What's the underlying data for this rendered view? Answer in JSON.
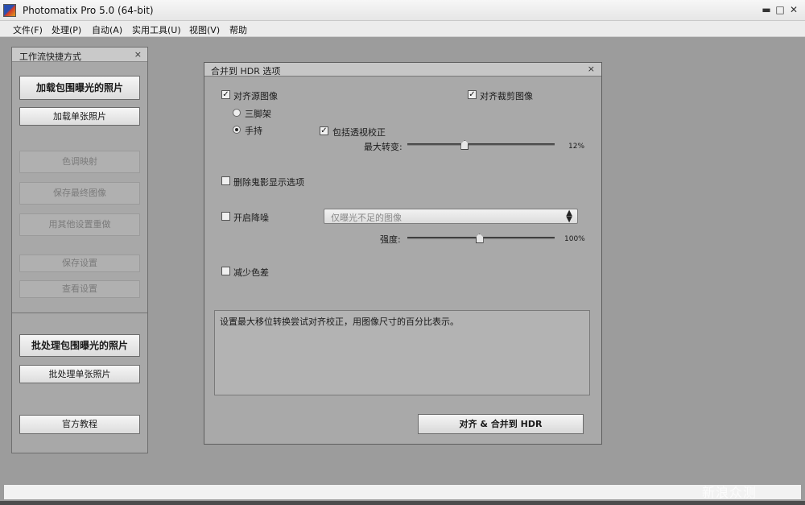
{
  "window": {
    "title": "Photomatix Pro 5.0 (64-bit)",
    "min": "▬",
    "max": "□",
    "close": "✕"
  },
  "menu": [
    "文件(F)",
    "处理(P)",
    "自动(A)",
    "实用工具(U)",
    "视图(V)",
    "帮助"
  ],
  "workflow": {
    "title": "工作流快捷方式",
    "close": "×",
    "load_bracketed": "加载包围曝光的照片",
    "load_single": "加载单张照片",
    "tone_mapping": "色调映射",
    "save_final": "保存最终图像",
    "reprocess": "用其他设置重做",
    "save_settings": "保存设置",
    "view_settings": "查看设置",
    "batch_bracketed": "批处理包围曝光的照片",
    "batch_single": "批处理单张照片",
    "tutorials": "官方教程"
  },
  "dialog": {
    "title": "合并到 HDR 选项",
    "close": "×",
    "align_source": {
      "label": "对齐源图像",
      "checked": true
    },
    "crop_aligned": {
      "label": "对齐裁剪图像",
      "checked": true
    },
    "tripod": {
      "label": "三脚架",
      "selected": false
    },
    "handheld": {
      "label": "手持",
      "selected": true
    },
    "perspective": {
      "label": "包括透视校正",
      "checked": true
    },
    "max_shift": {
      "label": "最大转变:",
      "value": "12%",
      "fraction": 0.39
    },
    "deghost": {
      "label": "删除鬼影显示选项",
      "checked": false
    },
    "noise": {
      "label": "开启降噪",
      "checked": false
    },
    "noise_target": {
      "selected": "仅曝光不足的图像",
      "arrow": "▲▼"
    },
    "strength": {
      "label": "强度:",
      "value": "100%",
      "fraction": 0.49
    },
    "chromatic": {
      "label": "减少色差",
      "checked": false
    },
    "info": "设置最大移位转换尝试对齐校正，用图像尺寸的百分比表示。",
    "merge_button": "对齐 & 合并到 HDR"
  },
  "watermark": "新浪众测",
  "colors": {
    "panel": "#a8a8a8",
    "workspace": "#9c9c9c",
    "button": "#e8e8e8"
  }
}
